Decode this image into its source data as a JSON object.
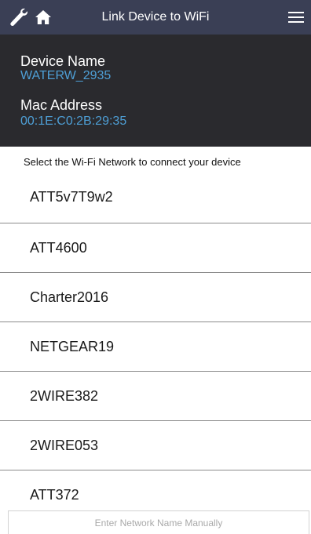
{
  "header": {
    "title": "Link Device to WiFi",
    "icons": [
      "wrench-icon",
      "home-icon",
      "menu-icon"
    ],
    "bg_color": "#3a3f55"
  },
  "device": {
    "name_label": "Device Name",
    "name_value": "WATERW_2935",
    "mac_label": "Mac Address",
    "mac_value": "00:1E:C0:2B:29:35",
    "value_color": "#4e9fd6"
  },
  "instruction": "Select the Wi-Fi Network to connect your device",
  "networks": [
    "ATT5v7T9w2",
    "ATT4600",
    "Charter2016",
    "NETGEAR19",
    "2WIRE382",
    "2WIRE053",
    "ATT372"
  ],
  "manual_input": {
    "placeholder": "Enter Network Name Manually"
  }
}
